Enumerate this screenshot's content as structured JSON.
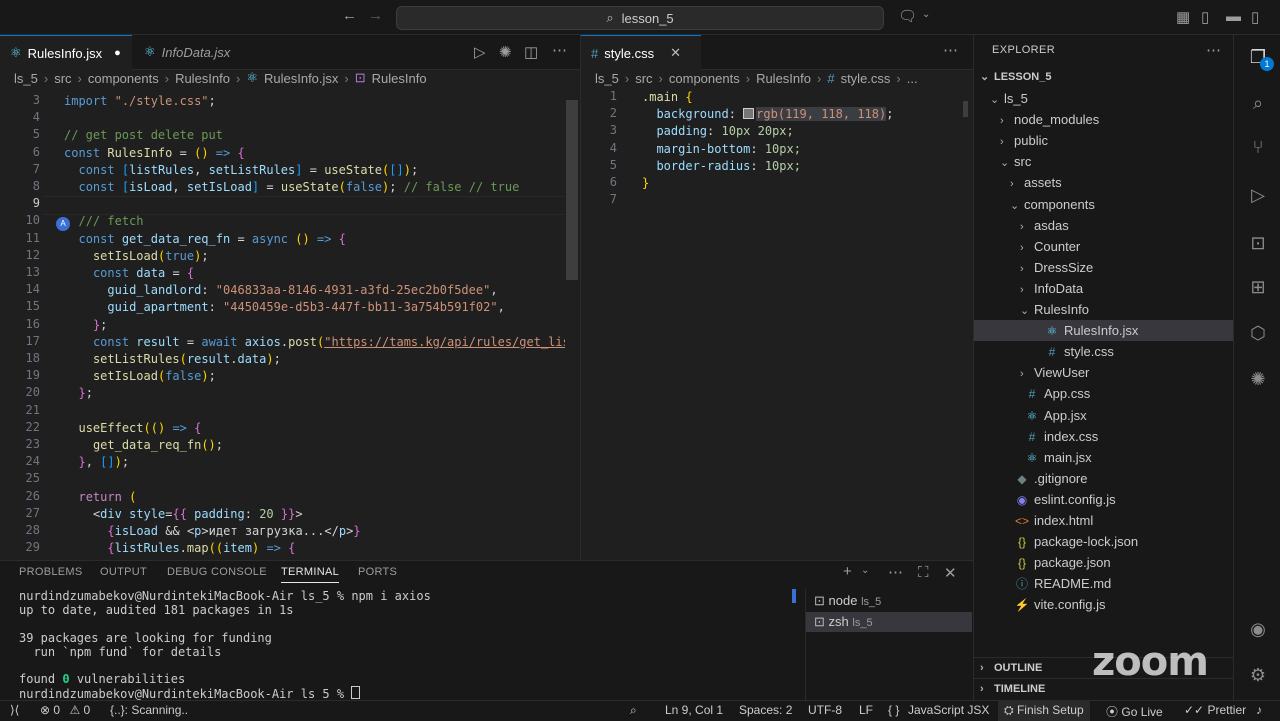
{
  "titlebar": {
    "search_text": "lesson_5"
  },
  "left_editor": {
    "tabs": [
      {
        "label": "RulesInfo.jsx",
        "modified": "●"
      },
      {
        "label": "InfoData.jsx"
      }
    ],
    "breadcrumb": [
      "ls_5",
      "src",
      "components",
      "RulesInfo",
      "RulesInfo.jsx",
      "RulesInfo"
    ],
    "codelens": "A",
    "lines": [
      {
        "n": "3",
        "t": "import \"./style.css\";"
      },
      {
        "n": "4",
        "t": ""
      },
      {
        "n": "5",
        "t": "// get post delete put"
      },
      {
        "n": "6",
        "t": "const RulesInfo = () => {"
      },
      {
        "n": "7",
        "t": "  const [listRules, setListRules] = useState([]);"
      },
      {
        "n": "8",
        "t": "  const [isLoad, setIsLoad] = useState(false); // false // true"
      },
      {
        "n": "9",
        "t": ""
      },
      {
        "n": "10",
        "t": "  /// fetch"
      },
      {
        "n": "11",
        "t": "  const get_data_req_fn = async () => {"
      },
      {
        "n": "12",
        "t": "    setIsLoad(true);"
      },
      {
        "n": "13",
        "t": "    const data = {"
      },
      {
        "n": "14",
        "t": "      guid_landlord: \"046833aa-8146-4931-a3fd-25ec2b0f5dee\","
      },
      {
        "n": "15",
        "t": "      guid_apartment: \"4450459e-d5b3-447f-bb11-3a754b591f02\","
      },
      {
        "n": "16",
        "t": "    };"
      },
      {
        "n": "17",
        "t": "    const result = await axios.post(\"https://tams.kg/api/rules/get_list\", d"
      },
      {
        "n": "18",
        "t": "    setListRules(result.data);"
      },
      {
        "n": "19",
        "t": "    setIsLoad(false);"
      },
      {
        "n": "20",
        "t": "  };"
      },
      {
        "n": "21",
        "t": ""
      },
      {
        "n": "22",
        "t": "  useEffect(() => {"
      },
      {
        "n": "23",
        "t": "    get_data_req_fn();"
      },
      {
        "n": "24",
        "t": "  }, []);"
      },
      {
        "n": "25",
        "t": ""
      },
      {
        "n": "26",
        "t": "  return ("
      },
      {
        "n": "27",
        "t": "    <div style={{ padding: 20 }}>"
      },
      {
        "n": "28",
        "t": "      {isLoad && <p>идет загрузка...</p>}"
      },
      {
        "n": "29",
        "t": "      {listRules.map((item) => {"
      }
    ]
  },
  "right_editor": {
    "tabs": [
      {
        "label": "style.css"
      }
    ],
    "breadcrumb": [
      "ls_5",
      "src",
      "components",
      "RulesInfo",
      "style.css",
      "..."
    ],
    "lines": [
      {
        "n": "1",
        "t": ".main {"
      },
      {
        "n": "2",
        "t": "  background: ",
        "color_value": "rgb(119, 118, 118)",
        "tail": ";"
      },
      {
        "n": "3",
        "t": "  padding: 10px 20px;"
      },
      {
        "n": "4",
        "t": "  margin-bottom: 10px;"
      },
      {
        "n": "5",
        "t": "  border-radius: 10px;"
      },
      {
        "n": "6",
        "t": "}"
      },
      {
        "n": "7",
        "t": ""
      }
    ],
    "swatch_color": "#777676"
  },
  "explorer": {
    "header": "EXPLORER",
    "root": "LESSON_5",
    "items": [
      {
        "label": "ls_5",
        "kind": "folder-open"
      },
      {
        "label": "node_modules",
        "kind": "folder"
      },
      {
        "label": "public",
        "kind": "folder"
      },
      {
        "label": "src",
        "kind": "folder-open"
      },
      {
        "label": "assets",
        "kind": "folder"
      },
      {
        "label": "components",
        "kind": "folder-open"
      },
      {
        "label": "asdas",
        "kind": "folder"
      },
      {
        "label": "Counter",
        "kind": "folder"
      },
      {
        "label": "DressSize",
        "kind": "folder"
      },
      {
        "label": "InfoData",
        "kind": "folder"
      },
      {
        "label": "RulesInfo",
        "kind": "folder-open"
      },
      {
        "label": "RulesInfo.jsx",
        "kind": "jsx"
      },
      {
        "label": "style.css",
        "kind": "css"
      },
      {
        "label": "ViewUser",
        "kind": "folder"
      },
      {
        "label": "App.css",
        "kind": "css"
      },
      {
        "label": "App.jsx",
        "kind": "jsx"
      },
      {
        "label": "index.css",
        "kind": "css"
      },
      {
        "label": "main.jsx",
        "kind": "jsx"
      },
      {
        "label": ".gitignore",
        "kind": "git"
      },
      {
        "label": "eslint.config.js",
        "kind": "eslint"
      },
      {
        "label": "index.html",
        "kind": "html"
      },
      {
        "label": "package-lock.json",
        "kind": "json"
      },
      {
        "label": "package.json",
        "kind": "json"
      },
      {
        "label": "README.md",
        "kind": "md"
      },
      {
        "label": "vite.config.js",
        "kind": "vite"
      }
    ],
    "outline": "OUTLINE",
    "timeline": "TIMELINE"
  },
  "panel": {
    "tabs": [
      "PROBLEMS",
      "OUTPUT",
      "DEBUG CONSOLE",
      "TERMINAL",
      "PORTS"
    ],
    "terminal_lines": [
      "nurdindzumabekov@NurdintekiMacBook-Air ls_5 % npm i axios",
      "up to date, audited 181 packages in 1s",
      "",
      "39 packages are looking for funding",
      "  run `npm fund` for details",
      "",
      "found 0 vulnerabilities",
      "nurdindzumabekov@NurdintekiMacBook-Air ls_5 % "
    ],
    "sessions": [
      {
        "name": "node",
        "dir": "ls_5"
      },
      {
        "name": "zsh",
        "dir": "ls_5"
      }
    ]
  },
  "status": {
    "errors": "0",
    "warnings": "0",
    "scanning": "{..}: Scanning..",
    "position": "Ln 9, Col 1",
    "spaces": "Spaces: 2",
    "encoding": "UTF-8",
    "eol": "LF",
    "language": "JavaScript JSX",
    "finish_setup": "Finish Setup",
    "go_live": "Go Live",
    "prettier": "Prettier"
  },
  "watermark": "zoom",
  "activity_badge": "1"
}
